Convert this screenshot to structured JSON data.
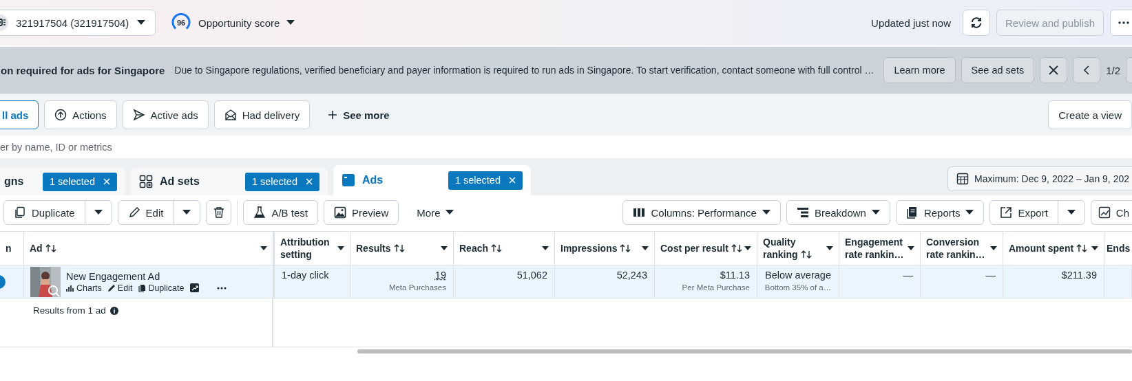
{
  "account_selector": {
    "label": "321917504 (321917504)"
  },
  "opportunity_score": {
    "score": "96",
    "label": "Opportunity score"
  },
  "status": "Updated just now",
  "publish_button": {
    "label": "Review and publish",
    "disabled": true
  },
  "banner": {
    "title": "on required for ads for Singapore",
    "message": "Due to Singapore regulations, verified beneficiary and payer information is required to run ads in Singapore. To start verification, contact someone with full control …",
    "buttons": [
      "Learn more",
      "See ad sets"
    ],
    "page": "1/2"
  },
  "filters": [
    {
      "label": "ll ads",
      "selected": true
    },
    {
      "label": "Actions",
      "selected": false
    },
    {
      "label": "Active ads",
      "selected": false
    },
    {
      "label": "Had delivery",
      "selected": false
    }
  ],
  "see_more": "See more",
  "create_view": "Create a view",
  "search": {
    "placeholder": "er by name, ID or metrics"
  },
  "tabs": [
    {
      "label": "gns",
      "badge": "1 selected",
      "selected": false
    },
    {
      "label": "Ad sets",
      "badge": "1 selected",
      "selected": false
    },
    {
      "label": "Ads",
      "badge": "1 selected",
      "selected": true
    }
  ],
  "date_range": "Maximum: Dec 9, 2022 – Jan 9, 202",
  "toolbar_left": [
    {
      "label": "Duplicate",
      "kind": "split"
    },
    {
      "label": "Edit",
      "kind": "split"
    },
    {
      "kind": "icon"
    },
    {
      "label": "A/B test",
      "kind": "plain"
    },
    {
      "label": "Preview",
      "kind": "plain"
    },
    {
      "label": "More",
      "kind": "menu"
    }
  ],
  "toolbar_right": [
    {
      "label": "Columns: Performance",
      "kind": "dropdown"
    },
    {
      "label": "Breakdown",
      "kind": "dropdown"
    },
    {
      "label": "Reports",
      "kind": "dropdown"
    },
    {
      "label": "Export",
      "kind": "split"
    },
    {
      "label": "Ch",
      "kind": "plain"
    }
  ],
  "table": {
    "columns": [
      {
        "label": "n",
        "sortable": false
      },
      {
        "label": "Ad",
        "sortable": true
      },
      {
        "label": "Attribution setting",
        "sortable": false
      },
      {
        "label": "Results",
        "sortable": true
      },
      {
        "label": "Reach",
        "sortable": true
      },
      {
        "label": "Impressions",
        "sortable": true
      },
      {
        "label": "Cost per result",
        "sortable": true
      },
      {
        "label": "Quality ranking",
        "sortable": true
      },
      {
        "label": "Engagement rate rankin…",
        "sortable": false
      },
      {
        "label": "Conversion rate rankin…",
        "sortable": false
      },
      {
        "label": "Amount spent",
        "sortable": true
      },
      {
        "label": "Ends",
        "sortable": false
      }
    ],
    "rows": [
      {
        "selected": true,
        "cells": [
          {
            "kind": "toggle",
            "on": true
          },
          {
            "kind": "ad",
            "value": "New Engagement Ad",
            "actions": [
              "Charts",
              "Edit",
              "Duplicate"
            ]
          },
          {
            "kind": "text",
            "value": "1-day click"
          },
          {
            "kind": "number",
            "value": "19",
            "sub": "Meta Purchases"
          },
          {
            "kind": "number",
            "value": "51,062"
          },
          {
            "kind": "number",
            "value": "52,243"
          },
          {
            "kind": "number",
            "value": "$11.13",
            "sub": "Per Meta Purchase"
          },
          {
            "kind": "ranking",
            "value": "Below average",
            "sub": "Bottom 35% of a…"
          },
          {
            "kind": "number",
            "value": "—"
          },
          {
            "kind": "number",
            "value": "—"
          },
          {
            "kind": "number",
            "value": "$211.39"
          }
        ]
      }
    ],
    "footer": "Results from 1 ad"
  }
}
